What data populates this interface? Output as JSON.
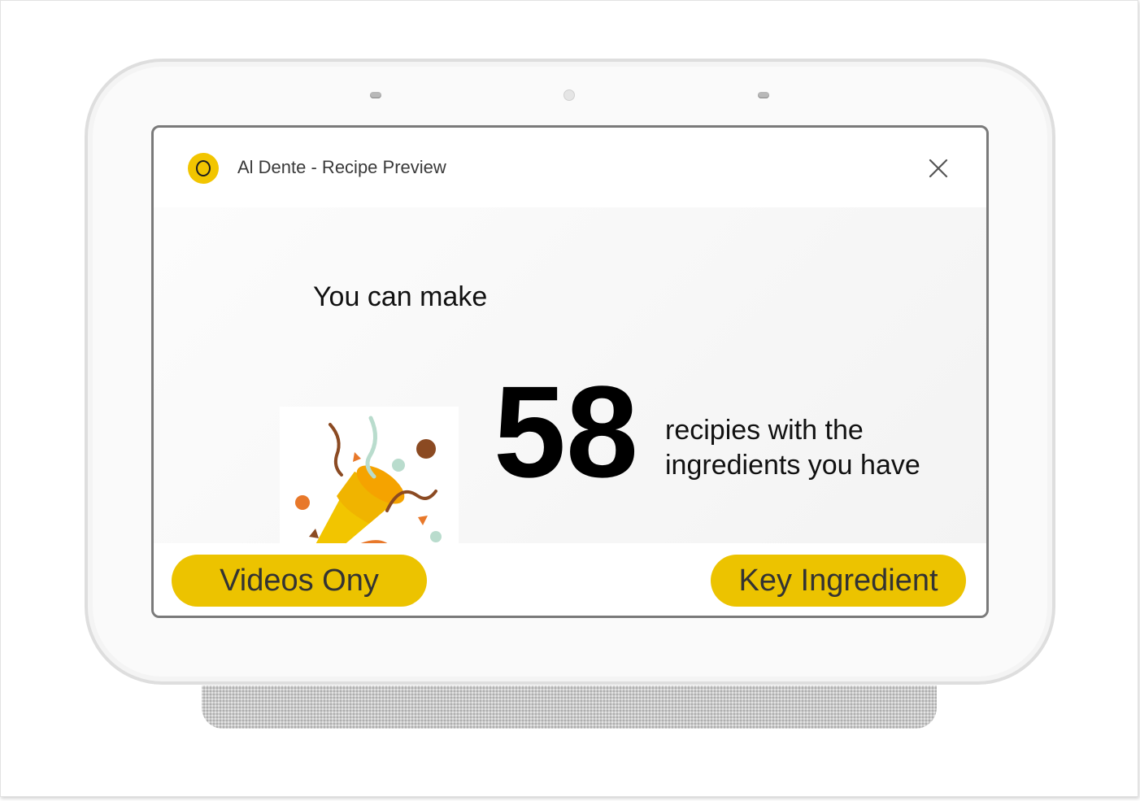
{
  "app": {
    "title": "Al Dente - Recipe Preview",
    "logo_icon": "al-dente-logo-icon",
    "close_icon": "close-icon",
    "accent_color": "#ECC300"
  },
  "result": {
    "lead": "You can make",
    "count": "58",
    "tail_line1": "recipies with the",
    "tail_line2": "ingredients you have",
    "illustration_icon": "party-popper-icon"
  },
  "actions": {
    "left_label": "Videos Ony",
    "right_label": "Key Ingredient"
  }
}
